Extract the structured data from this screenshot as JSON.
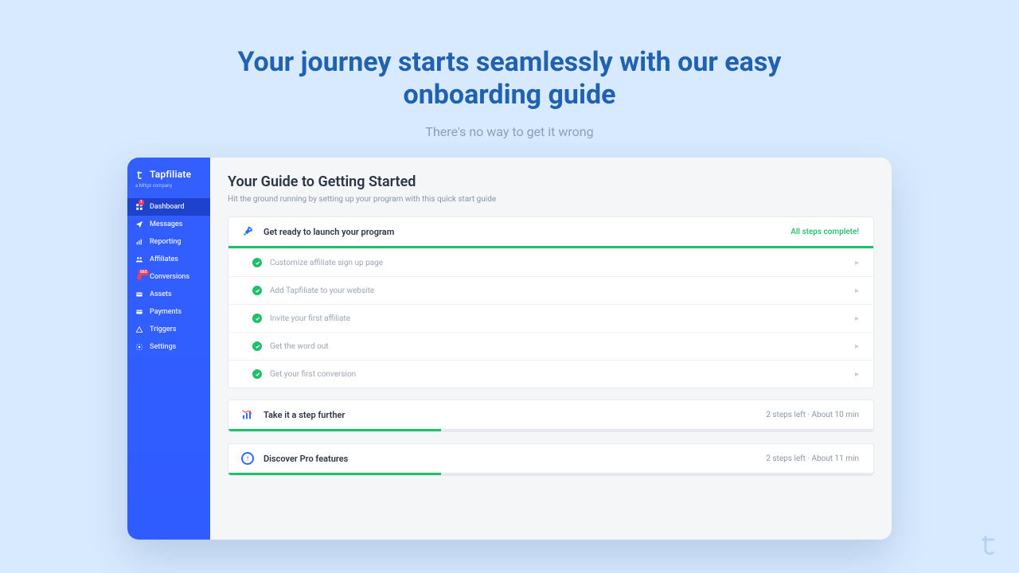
{
  "hero": {
    "title": "Your journey starts seamlessly with our easy onboarding guide",
    "subtitle": "There's no way to get it wrong"
  },
  "brand": {
    "name": "Tapfiliate",
    "tagline": "a Mitgo company"
  },
  "sidebar": {
    "items": [
      {
        "label": "Dashboard",
        "icon": "grid-icon",
        "active": true,
        "badge": "1"
      },
      {
        "label": "Messages",
        "icon": "paper-plane-icon"
      },
      {
        "label": "Reporting",
        "icon": "chart-icon"
      },
      {
        "label": "Affiliates",
        "icon": "people-icon"
      },
      {
        "label": "Conversions",
        "icon": "shopping-bag-icon",
        "badge": "563"
      },
      {
        "label": "Assets",
        "icon": "wallet-icon"
      },
      {
        "label": "Payments",
        "icon": "credit-card-icon"
      },
      {
        "label": "Triggers",
        "icon": "triangle-icon"
      },
      {
        "label": "Settings",
        "icon": "gear-icon"
      }
    ]
  },
  "page": {
    "title": "Your Guide to Getting Started",
    "subtitle": "Hit the ground running by setting up your program with this quick start guide"
  },
  "cards": {
    "launch": {
      "title": "Get ready to launch your program",
      "status": "All steps complete!",
      "progress": 100,
      "steps": [
        "Customize affiliate sign up page",
        "Add Tapfiliate to your website",
        "Invite your first affiliate",
        "Get the word out",
        "Get your first conversion"
      ]
    },
    "further": {
      "title": "Take it a step further",
      "meta": "2 steps left · About 10 min",
      "progress": 33
    },
    "pro": {
      "title": "Discover Pro features",
      "meta": "2 steps left · About 11 min",
      "progress": 33
    }
  },
  "colors": {
    "accent_blue": "#2f5cff",
    "heading_blue": "#2062b0",
    "success_green": "#1fbf6b"
  }
}
